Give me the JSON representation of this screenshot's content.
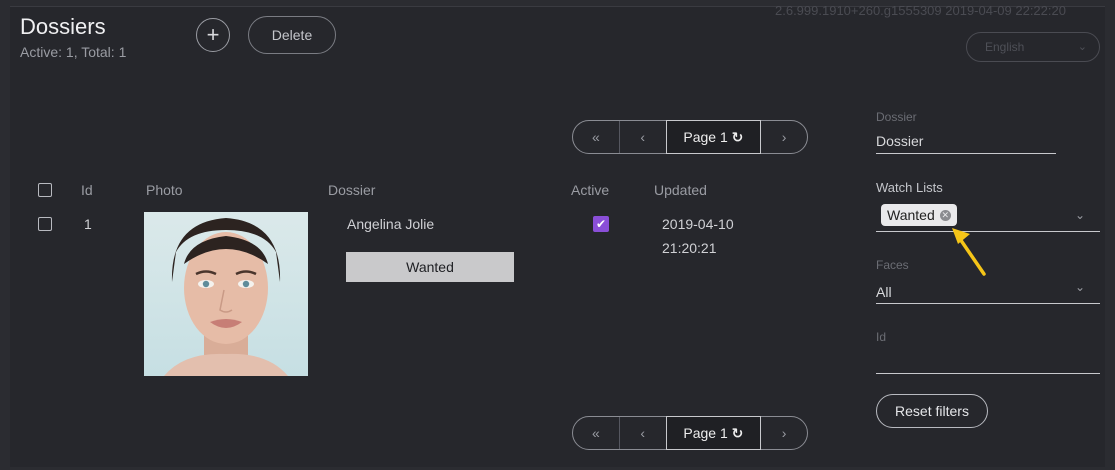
{
  "header": {
    "title": "Dossiers",
    "subtitle": "Active: 1, Total: 1",
    "add_label": "+",
    "delete_label": "Delete",
    "version": "2.6.999.1910+260.g1555309 2019-04-09 22:22:20",
    "language": "English"
  },
  "pager": {
    "first": "«",
    "prev": "‹",
    "page_label": "Page 1",
    "refresh_icon": "↻",
    "next": "›"
  },
  "table": {
    "columns": [
      "Id",
      "Photo",
      "Dossier",
      "Active",
      "Updated"
    ],
    "rows": [
      {
        "id": "1",
        "name": "Angelina Jolie",
        "watch_list": "Wanted",
        "active": true,
        "updated_date": "2019-04-10",
        "updated_time": "21:20:21"
      }
    ]
  },
  "filters": {
    "dossier_label": "Dossier",
    "dossier_value": "Dossier",
    "watch_lists_label": "Watch Lists",
    "watch_list_chip": "Wanted",
    "faces_label": "Faces",
    "faces_value": "All",
    "id_label": "Id",
    "reset_label": "Reset filters"
  },
  "colors": {
    "background": "#26272c",
    "accent_checkbox": "#8a4fd8",
    "annotation_arrow": "#f5c518"
  }
}
